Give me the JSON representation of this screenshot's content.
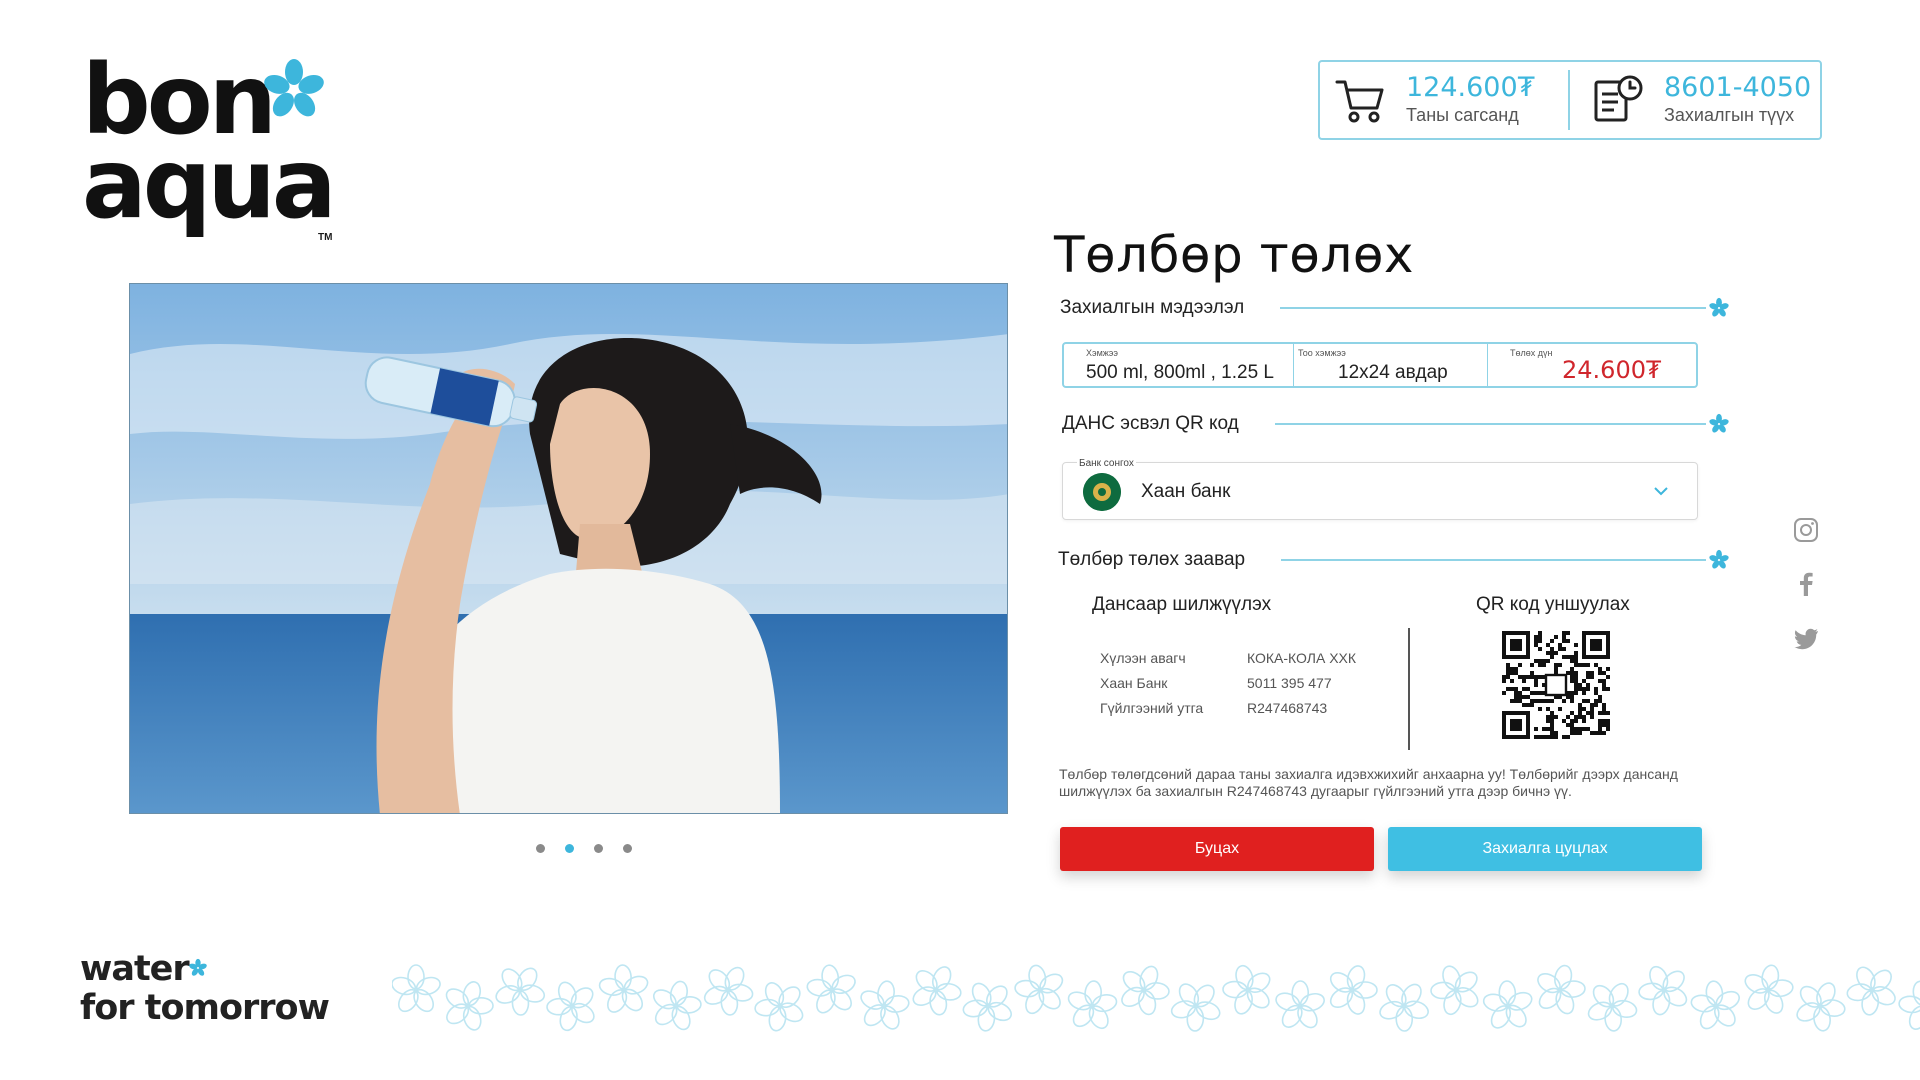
{
  "brand": {
    "logo_line1": "bon",
    "logo_line2": "aqua",
    "trademark": "TM",
    "tagline_line1": "water",
    "tagline_line2": "for tomorrow"
  },
  "header": {
    "cart_value": "124.600₮",
    "cart_label": "Таны сагсанд",
    "orders_value": "8601-4050",
    "orders_label": "Захиалгын түүх"
  },
  "carousel": {
    "slide_count": 4,
    "active_slide": 2
  },
  "payment": {
    "title": "Төлбөр төлөх",
    "section_order": "Захиалгын мэдээлэл",
    "order": {
      "size_label": "Хэмжээ",
      "size_value": "500 ml, 800ml , 1.25 L",
      "qty_label": "Тоо хэмжээ",
      "qty_value": "12x24 авдар",
      "sum_label": "Төлөх дүн",
      "sum_value": "24.600₮"
    },
    "section_account": "ДАНС эсвэл QR код",
    "bank": {
      "select_label": "Банк сонгох",
      "selected": "Хаан банк"
    },
    "section_instructions": "Төлбөр төлөх заавар",
    "transfer": {
      "heading": "Дансаар шилжүүлэх",
      "rows": [
        {
          "key": "Хүлээн авагч",
          "value": "КОКА-КОЛА ХХК"
        },
        {
          "key": "Хаан Банк",
          "value": "5011 395 477"
        },
        {
          "key": "Гүйлгээний утга",
          "value": "R247468743"
        }
      ]
    },
    "qr_heading": "QR код уншуулах",
    "note": "Төлбөр төлөгдсөний дараа таны захиалга идэвхжихийг анхаарна уу! Төлбөрийг дээрх дансанд шилжүүлэх ба захиалгын R247468743 дугаарыг гүйлгээний утга дээр бичнэ үү.",
    "back_button": "Буцах",
    "cancel_button": "Захиалга цуцлах"
  },
  "social": [
    "instagram-icon",
    "facebook-icon",
    "twitter-icon"
  ],
  "colors": {
    "accent": "#3db6dc",
    "accent_light": "#8fd3e6",
    "danger": "#e0201f",
    "price": "#d0262c"
  }
}
